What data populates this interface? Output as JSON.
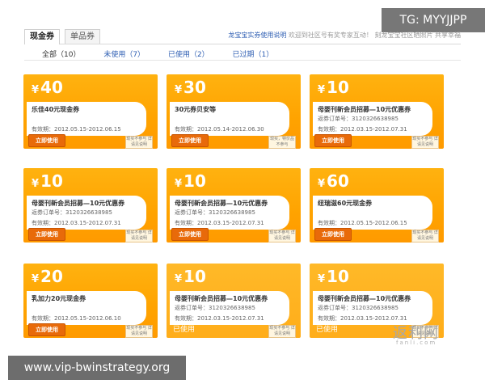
{
  "tabs": [
    {
      "label": "现金券"
    },
    {
      "label": "单品券"
    }
  ],
  "notice": {
    "link": "龙宝宝实券使用说明",
    "text": "欢迎到社区号有奖专家互动！ 刻龙宝宝社区晒照片 共享幸福"
  },
  "filters": [
    {
      "label": "全部（10）"
    },
    {
      "label": "未使用（7）"
    },
    {
      "label": "已使用（2）"
    },
    {
      "label": "已过期（1）"
    }
  ],
  "coupons": [
    {
      "currency": "¥",
      "amount": "40",
      "name": "乐佳40元现金券",
      "order": "",
      "valid": "有效期：2012.05.15-2012.06.15",
      "action": "立即使用",
      "note": "现买不参与 详请见说明"
    },
    {
      "currency": "¥",
      "amount": "30",
      "name": "30元券贝安等",
      "order": "",
      "valid": "有效期：2012.05.14-2012.06.30",
      "action": "立即使用",
      "note": "现买，特价品不参与"
    },
    {
      "currency": "¥",
      "amount": "10",
      "name": "母婴刊新会员招募—10元优惠券",
      "order": "返券订单号：3120326638985",
      "valid": "有效期：2012.03.15-2012.07.31",
      "action": "立即使用",
      "note": "现买不参与 详请见说明"
    },
    {
      "currency": "¥",
      "amount": "10",
      "name": "母婴刊新会员招募—10元优惠券",
      "order": "返券订单号：3120326638985",
      "valid": "有效期：2012.03.15-2012.07.31",
      "action": "立即使用",
      "note": "现买不参与 详请见说明"
    },
    {
      "currency": "¥",
      "amount": "10",
      "name": "母婴刊新会员招募—10元优惠券",
      "order": "返券订单号：3120326638985",
      "valid": "有效期：2012.03.15-2012.07.31",
      "action": "立即使用",
      "note": "现买不参与 详请见说明"
    },
    {
      "currency": "¥",
      "amount": "60",
      "name": "纽瑞滋60元现金券",
      "order": "",
      "valid": "有效期：2012.05.15-2012.06.15",
      "action": "立即使用",
      "note": "现买不参与 详请见说明"
    },
    {
      "currency": "¥",
      "amount": "20",
      "name": "乳加力20元现金券",
      "order": "",
      "valid": "有效期：2012.05.15-2012.06.10",
      "action": "立即使用",
      "note": "现买不参与 详请见说明"
    },
    {
      "currency": "¥",
      "amount": "10",
      "name": "母婴刊新会员招募—10元优惠券",
      "order": "返券订单号：3120326638985",
      "valid": "有效期：2012.03.15-2012.07.31",
      "action": "已使用",
      "note": "现买不参与 详请见说明"
    },
    {
      "currency": "¥",
      "amount": "10",
      "name": "母婴刊新会员招募—10元优惠券",
      "order": "返券订单号：3120326638985",
      "valid": "有效期：2012.03.15-2012.07.31",
      "action": "已使用",
      "note": "现买不参与 详请见说明"
    }
  ],
  "badge": "TG: MYYJJPP",
  "footer": "www.vip-bwinstrategy.org",
  "watermark": {
    "main": "返利网",
    "sub": "fanli.com"
  }
}
